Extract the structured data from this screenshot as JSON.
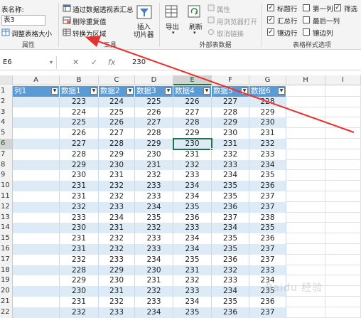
{
  "ribbon": {
    "properties": {
      "table_name_label": "表名称:",
      "table_name_value": "表3",
      "resize_label": "调整表格大小",
      "group_label": "属性"
    },
    "tools": {
      "pivot_label": "通过数据透视表汇总",
      "remove_dup_label": "删除重复值",
      "convert_label": "转换为区域",
      "slicer_label_1": "插入",
      "slicer_label_2": "切片器",
      "group_label": "工具"
    },
    "external": {
      "export_label": "导出",
      "refresh_label": "刷新",
      "properties_label": "属性",
      "open_browser_label": "用浏览器打开",
      "unlink_label": "取消链接",
      "group_label": "外部表数据"
    },
    "styles": {
      "header_row_label": "标题行",
      "first_col_label": "第一列",
      "filter_label": "筛选",
      "total_row_label": "汇总行",
      "last_col_label": "最后一列",
      "banded_rows_label": "镶边行",
      "banded_cols_label": "镶边列",
      "group_label": "表格样式选项",
      "checks": {
        "header_row": "✓",
        "total_row": "✓",
        "banded_rows": "✓",
        "filter": "✓"
      }
    }
  },
  "formula_bar": {
    "name_box": "E6",
    "cancel": "✕",
    "confirm": "✓",
    "fx": "fx",
    "value": "230"
  },
  "columns": [
    "A",
    "B",
    "C",
    "D",
    "E",
    "F",
    "G",
    "H",
    "I"
  ],
  "active_cell": "E6",
  "table": {
    "headers": [
      "列1",
      "数据1",
      "数据2",
      "数据3",
      "数据4",
      "数据5",
      "数据6"
    ],
    "rows": [
      [
        223,
        224,
        225,
        226,
        227,
        228
      ],
      [
        224,
        225,
        226,
        227,
        228,
        229
      ],
      [
        225,
        226,
        227,
        228,
        229,
        230
      ],
      [
        226,
        227,
        228,
        229,
        230,
        231
      ],
      [
        227,
        228,
        229,
        230,
        231,
        232
      ],
      [
        228,
        229,
        230,
        231,
        232,
        233
      ],
      [
        229,
        230,
        231,
        232,
        233,
        234
      ],
      [
        230,
        231,
        232,
        233,
        234,
        235
      ],
      [
        231,
        232,
        233,
        234,
        235,
        236
      ],
      [
        231,
        232,
        233,
        234,
        235,
        237
      ],
      [
        232,
        233,
        234,
        235,
        236,
        237
      ],
      [
        233,
        234,
        235,
        236,
        237,
        238
      ],
      [
        230,
        231,
        232,
        233,
        234,
        235
      ],
      [
        231,
        232,
        233,
        234,
        235,
        236
      ],
      [
        231,
        232,
        233,
        234,
        235,
        237
      ],
      [
        232,
        233,
        234,
        235,
        236,
        237
      ],
      [
        228,
        229,
        230,
        231,
        232,
        233
      ],
      [
        229,
        230,
        231,
        232,
        233,
        234
      ],
      [
        230,
        231,
        232,
        233,
        234,
        235
      ],
      [
        231,
        232,
        233,
        234,
        235,
        236
      ],
      [
        232,
        233,
        234,
        235,
        236,
        237
      ]
    ]
  },
  "row_numbers": [
    "1",
    "2",
    "3",
    "4",
    "5",
    "6",
    "7",
    "8",
    "9",
    "10",
    "11",
    "12",
    "13",
    "14",
    "15",
    "16",
    "17",
    "18",
    "19",
    "20",
    "21",
    "22"
  ],
  "colors": {
    "table_header": "#5b9bd5",
    "band": "#ddebf7",
    "accent": "#217346",
    "arrow": "#e8302c"
  },
  "watermark": "Baidu 经验"
}
